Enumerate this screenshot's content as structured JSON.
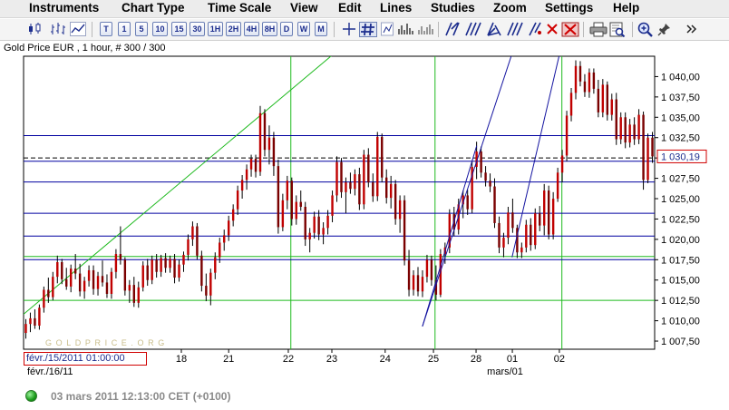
{
  "menu": [
    "Instruments",
    "Chart Type",
    "Time Scale",
    "View",
    "Edit",
    "Lines",
    "Studies",
    "Zoom",
    "Settings",
    "Help"
  ],
  "toolbar": {
    "timeframes": [
      "T",
      "1",
      "5",
      "10",
      "15",
      "30",
      "1H",
      "2H",
      "4H",
      "8H",
      "D",
      "W",
      "M"
    ]
  },
  "chart_header": "Gold Price EUR , 1 hour, # 300 / 300",
  "watermark": "GOLDPRICE.ORG",
  "date_box": "févr./15/2011 01:00:00",
  "status": "03 mars 2011 12:13:00  CET (+0100)",
  "colors": {
    "candle": "#c00000",
    "hline": "#0000a0",
    "green_line": "#1fba1f",
    "blue_trend": "#1414a0",
    "price_box": "#d00000"
  },
  "chart_data": {
    "type": "candlestick",
    "ylim": [
      1006.5,
      1042.5
    ],
    "yticks": [
      "1 007,50",
      "1 010,00",
      "1 012,50",
      "1 015,00",
      "1 017,50",
      "1 020,00",
      "1 022,50",
      "1 025,00",
      "1 027,50",
      "1 030,00",
      "1 032,50",
      "1 035,00",
      "1 037,50",
      "1 040,00"
    ],
    "ytick_values": [
      1007.5,
      1010,
      1012.5,
      1015,
      1017.5,
      1020,
      1022.5,
      1025,
      1027.5,
      1030,
      1032.5,
      1035,
      1037.5,
      1040
    ],
    "x_labels": [
      {
        "text": "18",
        "frac": 0.25
      },
      {
        "text": "21",
        "frac": 0.325
      },
      {
        "text": "22",
        "frac": 0.4195
      },
      {
        "text": "23",
        "frac": 0.4885
      },
      {
        "text": "24",
        "frac": 0.573
      },
      {
        "text": "25",
        "frac": 0.6495
      },
      {
        "text": "28",
        "frac": 0.717
      },
      {
        "text": "01",
        "frac": 0.7745
      },
      {
        "text": "02",
        "frac": 0.849
      }
    ],
    "x_labels_row2": [
      {
        "text": "févr./16/11",
        "frac": 0.042
      },
      {
        "text": "mars/01",
        "frac": 0.763
      }
    ],
    "current_price": "1 030,19",
    "current_price_value": 1030.19,
    "horizontal_lines": [
      1032.75,
      1030.0,
      1029.6,
      1027.05,
      1023.2,
      1020.4,
      1017.9,
      1017.5,
      1012.5
    ],
    "horizontal_line_colors": [
      "hline",
      "dash",
      "hline",
      "hline",
      "hline",
      "hline",
      "green_line",
      "hline",
      "green_line"
    ],
    "vertical_lines_frac": [
      0.4235,
      0.652,
      0.853
    ],
    "green_trend": [
      [
        0.0,
        1010.8
      ],
      [
        0.51,
        1044.0
      ]
    ],
    "blue_trends": [
      [
        [
          0.632,
          1009.3
        ],
        [
          0.718,
          1031.5
        ]
      ],
      [
        [
          0.632,
          1009.3
        ],
        [
          0.779,
          1044.0
        ]
      ],
      [
        [
          0.774,
          1017.8
        ],
        [
          0.853,
          1044.0
        ]
      ]
    ],
    "candles": [
      [
        1008.5,
        1010.2,
        1007.8,
        1009.6
      ],
      [
        1009.6,
        1011.0,
        1008.6,
        1010.3
      ],
      [
        1010.3,
        1011.4,
        1009.0,
        1009.4
      ],
      [
        1009.4,
        1012.0,
        1008.9,
        1011.6
      ],
      [
        1011.6,
        1014.2,
        1011.0,
        1013.8
      ],
      [
        1013.8,
        1015.3,
        1012.2,
        1012.9
      ],
      [
        1012.9,
        1016.0,
        1012.5,
        1015.4
      ],
      [
        1015.4,
        1018.0,
        1014.6,
        1017.2
      ],
      [
        1017.2,
        1017.6,
        1014.5,
        1015.1
      ],
      [
        1015.1,
        1016.5,
        1013.8,
        1014.2
      ],
      [
        1014.2,
        1016.9,
        1013.5,
        1016.4
      ],
      [
        1016.4,
        1018.2,
        1015.1,
        1015.8
      ],
      [
        1015.8,
        1017.0,
        1013.0,
        1013.6
      ],
      [
        1013.6,
        1015.4,
        1012.7,
        1014.9
      ],
      [
        1014.9,
        1016.8,
        1014.2,
        1016.2
      ],
      [
        1016.2,
        1016.8,
        1013.2,
        1013.9
      ],
      [
        1013.9,
        1016.0,
        1013.1,
        1015.5
      ],
      [
        1015.5,
        1017.4,
        1014.2,
        1014.7
      ],
      [
        1014.7,
        1015.7,
        1012.8,
        1013.3
      ],
      [
        1013.3,
        1016.5,
        1012.7,
        1016.0
      ],
      [
        1016.0,
        1018.8,
        1015.2,
        1018.2
      ],
      [
        1018.2,
        1021.6,
        1016.9,
        1017.5
      ],
      [
        1017.5,
        1017.8,
        1013.1,
        1013.7
      ],
      [
        1013.7,
        1015.0,
        1012.2,
        1014.4
      ],
      [
        1014.4,
        1015.4,
        1011.7,
        1012.2
      ],
      [
        1012.2,
        1014.8,
        1011.6,
        1014.1
      ],
      [
        1014.1,
        1017.3,
        1013.6,
        1016.8
      ],
      [
        1016.8,
        1017.6,
        1014.3,
        1015.0
      ],
      [
        1015.0,
        1018.0,
        1014.5,
        1017.5
      ],
      [
        1017.5,
        1018.2,
        1015.3,
        1016.0
      ],
      [
        1016.0,
        1018.1,
        1015.4,
        1017.7
      ],
      [
        1017.7,
        1018.3,
        1015.9,
        1016.5
      ],
      [
        1016.5,
        1018.0,
        1015.9,
        1017.6
      ],
      [
        1017.6,
        1018.2,
        1014.6,
        1015.3
      ],
      [
        1015.3,
        1017.5,
        1014.8,
        1016.9
      ],
      [
        1016.9,
        1018.5,
        1016.0,
        1018.1
      ],
      [
        1018.1,
        1020.6,
        1017.4,
        1020.0
      ],
      [
        1020.0,
        1022.2,
        1019.2,
        1021.6
      ],
      [
        1021.6,
        1022.0,
        1017.5,
        1018.0
      ],
      [
        1018.0,
        1018.6,
        1013.6,
        1014.3
      ],
      [
        1014.3,
        1015.8,
        1012.4,
        1013.1
      ],
      [
        1013.1,
        1016.4,
        1011.9,
        1015.9
      ],
      [
        1015.9,
        1018.4,
        1015.1,
        1017.8
      ],
      [
        1017.8,
        1020.2,
        1017.1,
        1019.6
      ],
      [
        1019.6,
        1021.2,
        1018.6,
        1020.5
      ],
      [
        1020.5,
        1022.9,
        1019.8,
        1022.3
      ],
      [
        1022.3,
        1024.3,
        1021.6,
        1023.7
      ],
      [
        1023.7,
        1026.6,
        1023.0,
        1026.0
      ],
      [
        1026.0,
        1027.9,
        1025.0,
        1027.3
      ],
      [
        1027.3,
        1029.2,
        1026.1,
        1028.6
      ],
      [
        1028.6,
        1030.4,
        1027.7,
        1029.9
      ],
      [
        1029.9,
        1030.4,
        1027.6,
        1028.3
      ],
      [
        1028.3,
        1036.4,
        1027.8,
        1035.5
      ],
      [
        1035.5,
        1036.0,
        1030.2,
        1031.0
      ],
      [
        1031.0,
        1034.0,
        1029.2,
        1032.5
      ],
      [
        1032.5,
        1033.2,
        1027.8,
        1029.0
      ],
      [
        1029.0,
        1029.8,
        1020.7,
        1021.5
      ],
      [
        1021.5,
        1025.6,
        1021.0,
        1024.8
      ],
      [
        1024.8,
        1027.8,
        1023.7,
        1027.2
      ],
      [
        1027.2,
        1027.6,
        1021.7,
        1022.5
      ],
      [
        1022.5,
        1025.4,
        1021.8,
        1024.6
      ],
      [
        1024.6,
        1026.0,
        1023.5,
        1024.0
      ],
      [
        1024.0,
        1024.6,
        1019.2,
        1020.0
      ],
      [
        1020.0,
        1021.4,
        1018.4,
        1020.8
      ],
      [
        1020.8,
        1023.4,
        1020.1,
        1022.8
      ],
      [
        1022.8,
        1023.6,
        1019.9,
        1020.6
      ],
      [
        1020.6,
        1022.1,
        1019.4,
        1021.4
      ],
      [
        1021.4,
        1023.6,
        1020.6,
        1022.9
      ],
      [
        1022.9,
        1026.0,
        1022.1,
        1025.4
      ],
      [
        1025.4,
        1030.2,
        1024.6,
        1029.5
      ],
      [
        1029.5,
        1030.0,
        1025.1,
        1025.8
      ],
      [
        1025.8,
        1027.6,
        1023.2,
        1027.0
      ],
      [
        1027.0,
        1028.2,
        1025.6,
        1026.2
      ],
      [
        1026.2,
        1028.6,
        1025.4,
        1028.0
      ],
      [
        1028.0,
        1028.8,
        1023.6,
        1024.3
      ],
      [
        1024.3,
        1031.0,
        1023.7,
        1030.4
      ],
      [
        1030.4,
        1031.2,
        1026.4,
        1027.0
      ],
      [
        1027.0,
        1028.1,
        1024.6,
        1025.3
      ],
      [
        1025.3,
        1033.2,
        1024.7,
        1032.6
      ],
      [
        1032.6,
        1033.0,
        1027.0,
        1027.6
      ],
      [
        1027.6,
        1028.6,
        1024.4,
        1025.1
      ],
      [
        1025.1,
        1027.8,
        1023.8,
        1026.8
      ],
      [
        1026.8,
        1027.3,
        1021.8,
        1022.5
      ],
      [
        1022.5,
        1025.4,
        1020.8,
        1024.8
      ],
      [
        1024.8,
        1025.4,
        1016.8,
        1017.4
      ],
      [
        1017.4,
        1018.7,
        1013.0,
        1013.8
      ],
      [
        1013.8,
        1016.2,
        1013.1,
        1015.6
      ],
      [
        1015.6,
        1016.6,
        1013.0,
        1013.6
      ],
      [
        1013.6,
        1016.2,
        1012.9,
        1015.4
      ],
      [
        1015.4,
        1018.1,
        1014.7,
        1017.5
      ],
      [
        1017.5,
        1018.0,
        1014.3,
        1015.0
      ],
      [
        1015.0,
        1016.8,
        1012.5,
        1013.2
      ],
      [
        1013.2,
        1018.8,
        1012.9,
        1018.2
      ],
      [
        1018.2,
        1019.6,
        1017.0,
        1019.0
      ],
      [
        1019.0,
        1023.7,
        1018.3,
        1023.1
      ],
      [
        1023.1,
        1024.0,
        1020.4,
        1021.2
      ],
      [
        1021.2,
        1025.0,
        1020.6,
        1024.3
      ],
      [
        1024.3,
        1026.0,
        1022.6,
        1025.4
      ],
      [
        1025.4,
        1026.1,
        1023.0,
        1023.7
      ],
      [
        1023.7,
        1029.6,
        1023.2,
        1028.9
      ],
      [
        1028.9,
        1032.0,
        1027.4,
        1030.8
      ],
      [
        1030.8,
        1031.4,
        1027.6,
        1028.2
      ],
      [
        1028.2,
        1029.0,
        1026.5,
        1027.2
      ],
      [
        1027.2,
        1028.1,
        1025.8,
        1026.5
      ],
      [
        1026.5,
        1027.5,
        1021.4,
        1022.0
      ],
      [
        1022.0,
        1022.8,
        1018.3,
        1019.0
      ],
      [
        1019.0,
        1020.8,
        1017.8,
        1020.2
      ],
      [
        1020.2,
        1024.0,
        1019.4,
        1023.3
      ],
      [
        1023.3,
        1025.0,
        1020.8,
        1021.4
      ],
      [
        1021.4,
        1021.8,
        1017.7,
        1018.4
      ],
      [
        1018.4,
        1019.6,
        1017.7,
        1019.0
      ],
      [
        1019.0,
        1022.4,
        1018.4,
        1021.8
      ],
      [
        1021.8,
        1022.6,
        1018.6,
        1019.3
      ],
      [
        1019.3,
        1023.8,
        1018.8,
        1023.2
      ],
      [
        1023.2,
        1024.1,
        1021.0,
        1021.7
      ],
      [
        1021.7,
        1026.8,
        1020.5,
        1026.0
      ],
      [
        1026.0,
        1026.6,
        1020.0,
        1020.6
      ],
      [
        1020.6,
        1025.8,
        1020.0,
        1025.0
      ],
      [
        1025.0,
        1028.8,
        1024.6,
        1028.2
      ],
      [
        1028.2,
        1031.0,
        1027.0,
        1030.3
      ],
      [
        1030.3,
        1035.8,
        1029.6,
        1035.2
      ],
      [
        1035.2,
        1038.6,
        1034.5,
        1038.0
      ],
      [
        1038.0,
        1042.0,
        1037.2,
        1041.3
      ],
      [
        1041.3,
        1041.9,
        1038.8,
        1039.4
      ],
      [
        1039.4,
        1040.3,
        1037.5,
        1038.1
      ],
      [
        1038.1,
        1041.0,
        1037.4,
        1040.5
      ],
      [
        1040.5,
        1041.0,
        1037.9,
        1038.5
      ],
      [
        1038.5,
        1039.6,
        1035.0,
        1035.6
      ],
      [
        1035.6,
        1039.7,
        1035.0,
        1039.0
      ],
      [
        1039.0,
        1039.4,
        1034.6,
        1035.3
      ],
      [
        1035.3,
        1037.9,
        1034.6,
        1037.2
      ],
      [
        1037.2,
        1038.0,
        1031.6,
        1032.3
      ],
      [
        1032.3,
        1035.6,
        1031.7,
        1035.0
      ],
      [
        1035.0,
        1035.6,
        1031.2,
        1031.9
      ],
      [
        1031.9,
        1034.8,
        1031.3,
        1034.1
      ],
      [
        1034.1,
        1035.0,
        1031.6,
        1032.3
      ],
      [
        1032.3,
        1036.0,
        1031.7,
        1035.3
      ],
      [
        1035.3,
        1035.7,
        1026.1,
        1027.3
      ],
      [
        1027.3,
        1033.0,
        1026.9,
        1032.5
      ],
      [
        1032.5,
        1033.2,
        1029.4,
        1030.19
      ]
    ]
  }
}
